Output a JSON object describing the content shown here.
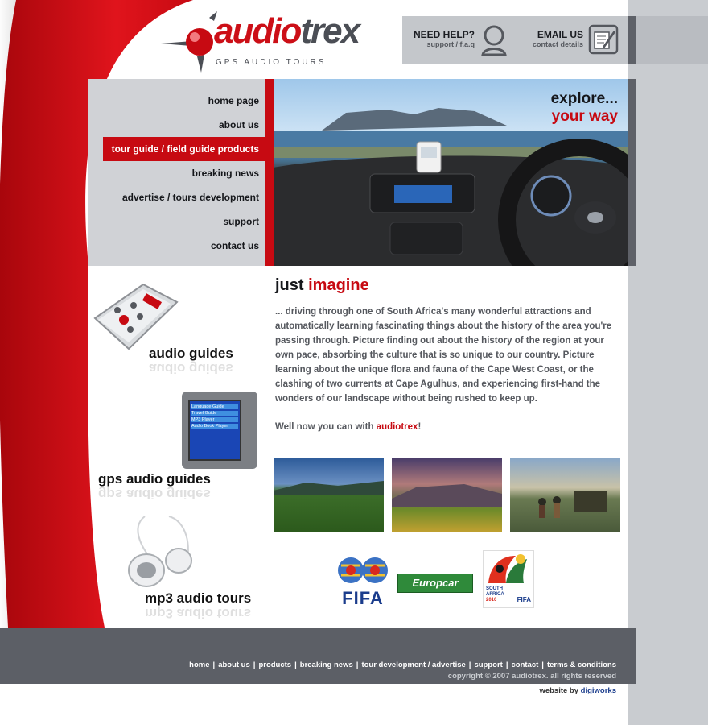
{
  "brand": {
    "name_part1": "audio",
    "name_part2": "trex",
    "tagline": "GPS AUDIO TOURS"
  },
  "help": {
    "need_help_title": "NEED HELP?",
    "need_help_sub": "support / f.a.q",
    "email_title": "EMAIL US",
    "email_sub": "contact details"
  },
  "nav": {
    "items": [
      {
        "label": "home page"
      },
      {
        "label": "about us"
      },
      {
        "label": "tour guide / field guide products",
        "active": true
      },
      {
        "label": "breaking news"
      },
      {
        "label": "advertise / tours development"
      },
      {
        "label": "support"
      },
      {
        "label": "contact us"
      }
    ]
  },
  "hero": {
    "line1": "explore...",
    "line2": "your way"
  },
  "products": [
    {
      "label": "audio guides"
    },
    {
      "label": "gps audio guides"
    },
    {
      "label": "mp3 audio tours"
    }
  ],
  "gps_menu": [
    "Language Guide",
    "Travel Guide",
    "MP3 Player",
    "Audio Book Player"
  ],
  "main": {
    "heading_part1": "just ",
    "heading_part2": "imagine",
    "body": "...  driving through one of South Africa's many wonderful attractions and automatically learning fascinating things about the history of the area you're passing through. Picture finding out about the history of the region at your own pace, absorbing the culture that is so unique to our country. Picture learning about the unique flora and fauna of the Cape West Coast, or the clashing of two currents at Cape Agulhus, and experiencing first-hand the wonders of our landscape without being rushed to keep up.",
    "cta_part1": "Well now you can with ",
    "cta_brand": "audiotrex",
    "cta_part2": "!"
  },
  "sponsors": {
    "fifa": "FIFA",
    "europcar": "Europcar",
    "wc_line1": "SOUTH",
    "wc_line2": "AFRICA",
    "wc_year": "2010",
    "wc_fifa": "FIFA"
  },
  "footer": {
    "links": [
      "home",
      "about us",
      "products",
      "breaking news",
      "tour development / advertise",
      "support",
      "contact",
      "terms & conditions"
    ],
    "separator": "|",
    "copyright": "copyright © 2007 audiotrex. all rights reserved",
    "credit_prefix": "website by ",
    "credit_name": "digiworks"
  },
  "colors": {
    "accent_red": "#c70a12",
    "dark_grey": "#5c5f66",
    "light_grey": "#c9ccd0"
  }
}
